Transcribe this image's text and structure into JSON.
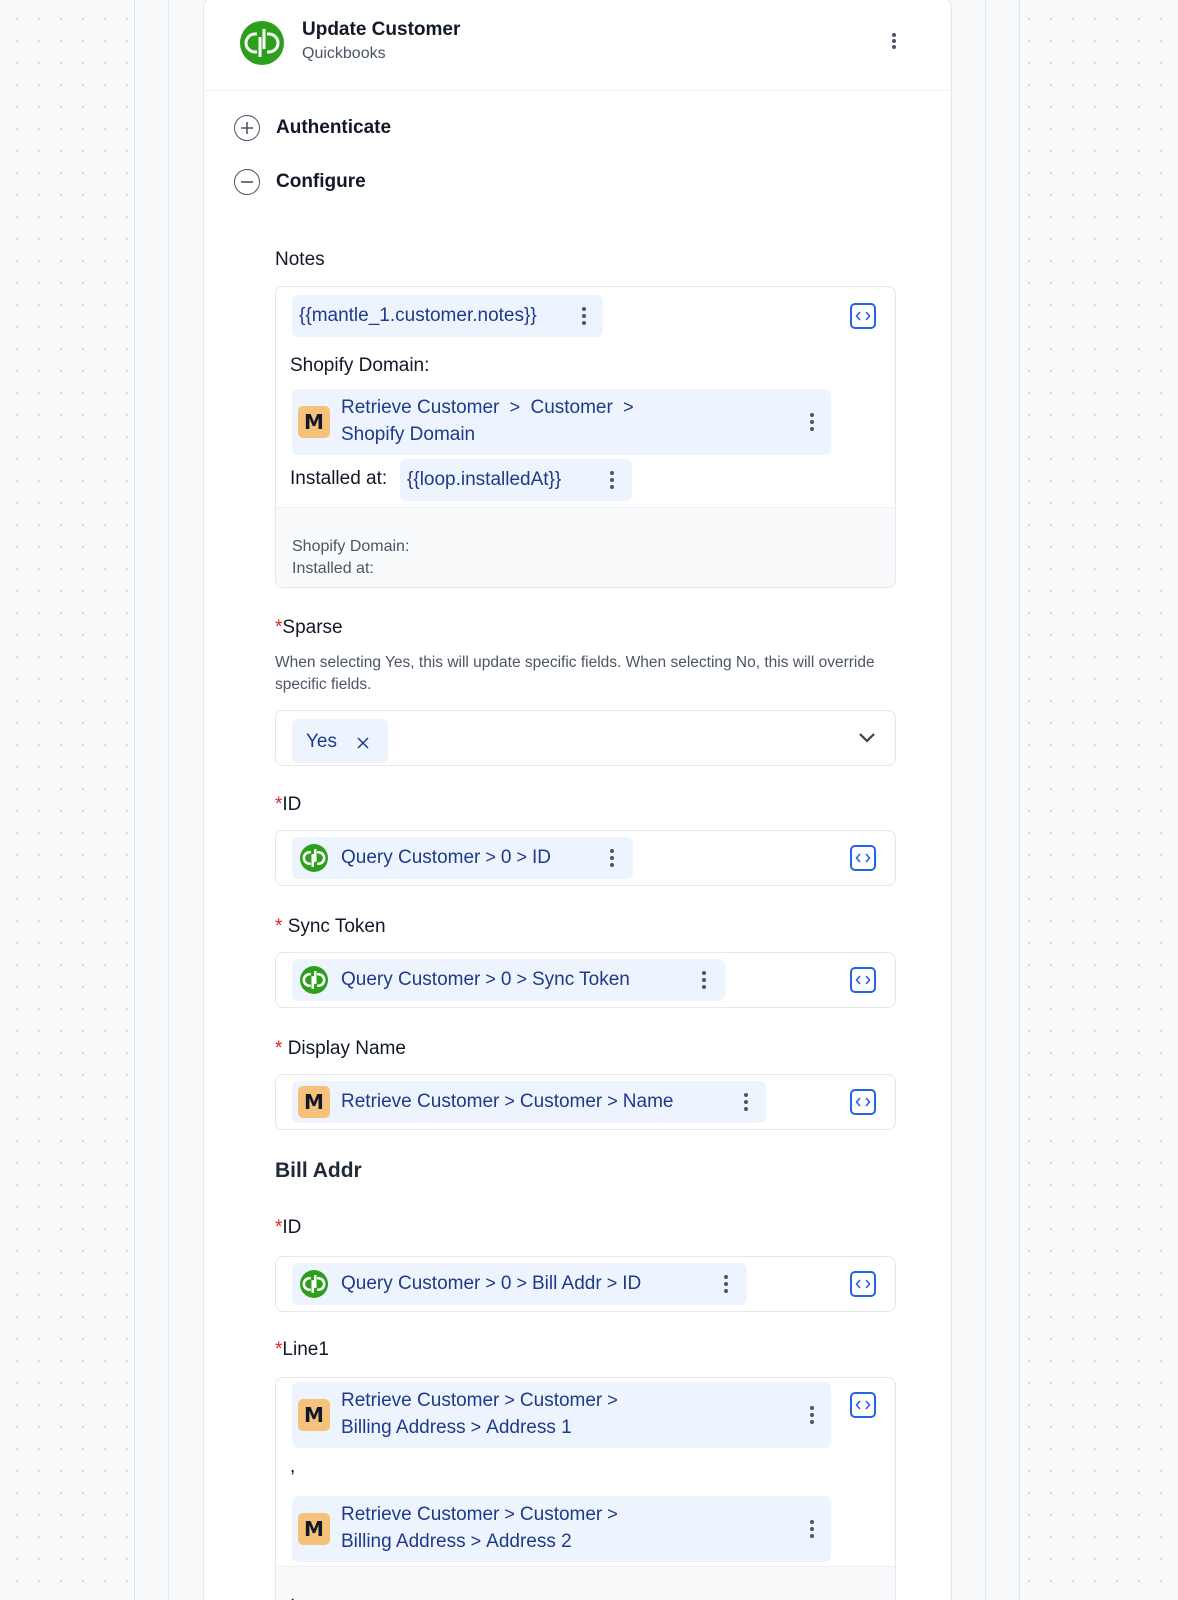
{
  "header": {
    "title": "Update Customer",
    "subtitle": "Quickbooks"
  },
  "steps": [
    {
      "label": "Authenticate",
      "state": "collapsed"
    },
    {
      "label": "Configure",
      "state": "expanded"
    }
  ],
  "fields": {
    "notes": {
      "label": "Notes",
      "var1": "{{mantle_1.customer.notes}}",
      "text_shopify": "Shopify Domain:",
      "chip_domain_line1": [
        "Retrieve Customer",
        "Customer"
      ],
      "chip_domain_line2": [
        "Shopify Domain"
      ],
      "text_installed": "Installed at:",
      "var2": "{{loop.installedAt}}",
      "preview_line1": "Shopify Domain:",
      "preview_line2": "Installed at:"
    },
    "sparse": {
      "required_mark": "*",
      "label": "Sparse",
      "help": "When selecting Yes, this will update specific fields. When selecting No, this will override specific fields.",
      "selected": "Yes"
    },
    "id": {
      "required_mark": "*",
      "label": "ID",
      "path": [
        "Query Customer",
        "0",
        "ID"
      ]
    },
    "sync_token": {
      "required_mark": "*",
      "label": "Sync Token",
      "path": [
        "Query Customer",
        "0",
        "Sync Token"
      ]
    },
    "display_name": {
      "required_mark": "*",
      "label": "Display Name",
      "path": [
        "Retrieve Customer",
        "Customer",
        "Name"
      ]
    },
    "bill_addr": {
      "section_title": "Bill Addr",
      "id": {
        "required_mark": "*",
        "label": "ID",
        "path": [
          "Query Customer",
          "0",
          "Bill Addr",
          "ID"
        ]
      },
      "line1": {
        "required_mark": "*",
        "label": "Line1",
        "chip1_line1": [
          "Retrieve Customer",
          "Customer"
        ],
        "chip1_line2": [
          "Billing Address",
          "Address 1"
        ],
        "separator": ",",
        "chip2_line1": [
          "Retrieve Customer",
          "Customer"
        ],
        "chip2_line2": [
          "Billing Address",
          "Address 2"
        ],
        "trailing": ","
      }
    }
  },
  "colors": {
    "quickbooks_green": "#2ca01c",
    "mantle_orange": "#f6c27a",
    "chip_bg": "#eef4fd",
    "chip_text": "#1e3a8a",
    "required": "#dc2626",
    "accent": "#2563eb"
  },
  "icons": [
    "quickbooks-logo-icon",
    "mantle-m-icon",
    "code-brackets-icon",
    "kebab-menu-icon",
    "chevron-right-icon",
    "chevron-down-icon",
    "close-x-icon",
    "plus-circle-icon",
    "minus-circle-icon"
  ]
}
